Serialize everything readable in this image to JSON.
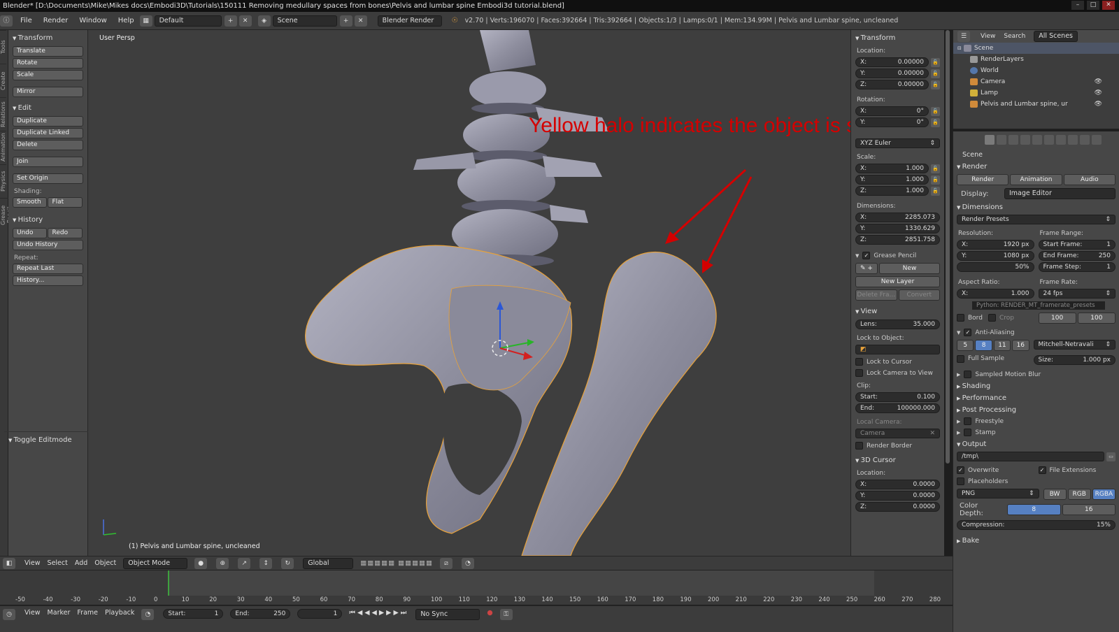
{
  "window": {
    "title": "Blender* [D:\\Documents\\Mike\\Mikes docs\\Embodi3D\\Tutorials\\150111 Removing medullary spaces from bones\\Pelvis and lumbar spine Embodi3d tutorial.blend]"
  },
  "menubar": {
    "items": [
      "File",
      "Render",
      "Window",
      "Help"
    ],
    "layout": "Default",
    "scene": "Scene",
    "engine": "Blender Render",
    "stats": "v2.70 | Verts:196070 | Faces:392664 | Tris:392664 | Objects:1/3 | Lamps:0/1 | Mem:134.99M | Pelvis and Lumbar spine, uncleaned"
  },
  "left_tabs": [
    "Tools",
    "Create",
    "Relations",
    "Animation",
    "Physics",
    "Grease Pencil"
  ],
  "toolshelf": {
    "transform_title": "Transform",
    "transform_buttons": [
      "Translate",
      "Rotate",
      "Scale"
    ],
    "mirror": "Mirror",
    "edit_title": "Edit",
    "edit_buttons": [
      "Duplicate",
      "Duplicate Linked",
      "Delete"
    ],
    "join": "Join",
    "set_origin": "Set Origin",
    "shading_label": "Shading:",
    "smooth": "Smooth",
    "flat": "Flat",
    "history_title": "History",
    "undo": "Undo",
    "redo": "Redo",
    "undo_history": "Undo History",
    "repeat_label": "Repeat:",
    "repeat_last": "Repeat Last",
    "history_btn": "History...",
    "toggle_editmode": "Toggle Editmode"
  },
  "viewport": {
    "label": "User Persp",
    "object_label": "(1) Pelvis and Lumbar spine, uncleaned",
    "annotation": "Yellow halo indicates the object is selected"
  },
  "npanel": {
    "transform_title": "Transform",
    "location_label": "Location:",
    "loc": [
      [
        "X:",
        "0.00000"
      ],
      [
        "Y:",
        "0.00000"
      ],
      [
        "Z:",
        "0.00000"
      ]
    ],
    "rotation_label": "Rotation:",
    "rot": [
      [
        "X:",
        "0°"
      ],
      [
        "Y:",
        "0°"
      ]
    ],
    "rotation_mode": "XYZ Euler",
    "scale_label": "Scale:",
    "scale": [
      [
        "X:",
        "1.000"
      ],
      [
        "Y:",
        "1.000"
      ],
      [
        "Z:",
        "1.000"
      ]
    ],
    "dimensions_label": "Dimensions:",
    "dims": [
      [
        "X:",
        "2285.073"
      ],
      [
        "Y:",
        "1330.629"
      ],
      [
        "Z:",
        "2851.758"
      ]
    ],
    "grease_title": "Grease Pencil",
    "new": "New",
    "new_layer": "New Layer",
    "delete_frame": "Delete Fra...",
    "convert": "Convert",
    "view_title": "View",
    "lens_label": "Lens:",
    "lens": "35.000",
    "lock_object": "Lock to Object:",
    "lock_cursor": "Lock to Cursor",
    "lock_camera": "Lock Camera to View",
    "clip_label": "Clip:",
    "clip_start_label": "Start:",
    "clip_start": "0.100",
    "clip_end_label": "End:",
    "clip_end": "100000.000",
    "local_camera": "Local Camera:",
    "camera": "Camera",
    "render_border": "Render Border",
    "cursor_title": "3D Cursor",
    "cursor_location": "Location:",
    "cursor": [
      [
        "X:",
        "0.0000"
      ],
      [
        "Y:",
        "0.0000"
      ],
      [
        "Z:",
        "0.0000"
      ]
    ]
  },
  "outliner": {
    "view": "View",
    "search": "Search",
    "filter": "All Scenes",
    "rows": [
      "Scene",
      "RenderLayers",
      "World",
      "Camera",
      "Lamp",
      "Pelvis and Lumbar spine, ur"
    ]
  },
  "properties": {
    "scene": "Scene",
    "render_title": "Render",
    "render": "Render",
    "animation": "Animation",
    "audio": "Audio",
    "display_label": "Display:",
    "display": "Image Editor",
    "dimensions_title": "Dimensions",
    "render_presets": "Render Presets",
    "resolution_label": "Resolution:",
    "res_x_label": "X:",
    "res_x": "1920 px",
    "res_y_label": "Y:",
    "res_y": "1080 px",
    "res_pct": "50%",
    "frame_range_label": "Frame Range:",
    "start_frame_label": "Start Frame:",
    "start_frame": "1",
    "end_frame_label": "End Frame:",
    "end_frame": "250",
    "frame_step_label": "Frame Step:",
    "frame_step": "1",
    "aspect_label": "Aspect Ratio:",
    "aspect_x_label": "X:",
    "aspect_x": "1.000",
    "frame_rate_label": "Frame Rate:",
    "frame_rate": "24 fps",
    "tooltip": "Python: RENDER_MT_framerate_presets",
    "border": "Bord",
    "crop": "Crop",
    "time_old": "100",
    "time_new": "100",
    "aa_title": "Anti-Aliasing",
    "aa_samples": [
      "5",
      "8",
      "11",
      "16"
    ],
    "filter": "Mitchell-Netravali",
    "full_sample": "Full Sample",
    "size_label": "Size:",
    "size": "1.000 px",
    "collapsed": [
      "Sampled Motion Blur",
      "Shading",
      "Performance",
      "Post Processing",
      "Freestyle",
      "Stamp"
    ],
    "output_title": "Output",
    "output_path": "/tmp\\",
    "overwrite": "Overwrite",
    "file_ext": "File Extensions",
    "placeholders": "Placeholders",
    "format": "PNG",
    "bw": "BW",
    "rgb": "RGB",
    "rgba": "RGBA",
    "color_depth_label": "Color Depth:",
    "depth8": "8",
    "depth16": "16",
    "compression_label": "Compression:",
    "compression": "15%",
    "bake": "Bake"
  },
  "viewport_header": {
    "items": [
      "View",
      "Select",
      "Add",
      "Object"
    ],
    "mode": "Object Mode",
    "orientation": "Global"
  },
  "timeline": {
    "ticks": [
      "-50",
      "-40",
      "-30",
      "-20",
      "-10",
      "0",
      "10",
      "20",
      "30",
      "40",
      "50",
      "60",
      "70",
      "80",
      "90",
      "100",
      "110",
      "120",
      "130",
      "140",
      "150",
      "160",
      "170",
      "180",
      "190",
      "200",
      "210",
      "220",
      "230",
      "240",
      "250",
      "260",
      "270",
      "280"
    ]
  },
  "timeline_header": {
    "items": [
      "View",
      "Marker",
      "Frame",
      "Playback"
    ],
    "start_label": "Start:",
    "start": "1",
    "end_label": "End:",
    "end": "250",
    "current": "1",
    "sync": "No Sync"
  },
  "colors": {
    "accent": "#5680c2",
    "annotation": "#d40000",
    "selection_halo": "#e8a23a",
    "playhead": "#3ea13e"
  }
}
